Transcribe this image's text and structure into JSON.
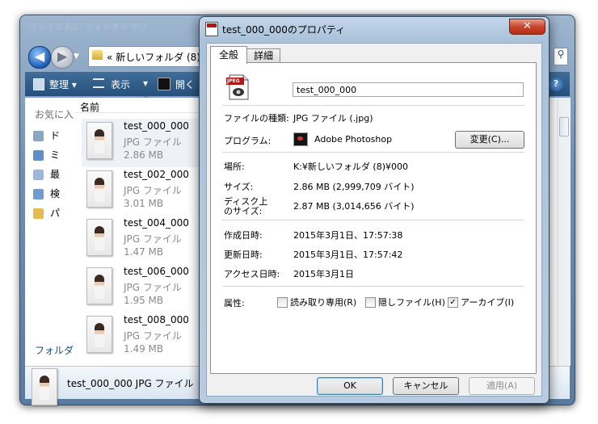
{
  "explorer": {
    "title": "ファイル名に フォトギャラリ",
    "address": "«  新しいフォルダ (8)",
    "toolbar": {
      "organize": "整理 ▾",
      "view": "表示",
      "open": "開く"
    },
    "nav_pane_header": "お気に入",
    "nav_items": [
      "ド",
      "ミ",
      "最",
      "検",
      "パ"
    ],
    "folder_label": "フォルダ",
    "column_header": "名前",
    "files": [
      {
        "name": "test_000_000",
        "type": "JPG ファイル",
        "size": "2.86 MB"
      },
      {
        "name": "test_002_000",
        "type": "JPG ファイル",
        "size": "3.01 MB"
      },
      {
        "name": "test_004_000",
        "type": "JPG ファイル",
        "size": "1.47 MB"
      },
      {
        "name": "test_006_000",
        "type": "JPG ファイル",
        "size": "1.95 MB"
      },
      {
        "name": "test_008_000",
        "type": "JPG ファイル",
        "size": "1.49 MB"
      }
    ],
    "status": "test_000_000 JPG ファイル"
  },
  "dialog": {
    "title": "test_000_000のプロパティ",
    "close": "✕",
    "tabs": [
      "全般",
      "詳細"
    ],
    "filename": "test_000_000",
    "icon_badge": "JPEG",
    "file_type_label": "ファイルの種類:",
    "file_type_value": "JPG ファイル (.jpg)",
    "program_label": "プログラム:",
    "program_value": "Adobe Photoshop",
    "change_button": "変更(C)...",
    "location_label": "場所:",
    "location_value": "K:¥新しいフォルダ (8)¥000",
    "size_label": "サイズ:",
    "size_value": "2.86 MB (2,999,709 バイト)",
    "disk_size_label_1": "ディスク上",
    "disk_size_label_2": "のサイズ:",
    "disk_size_value": "2.87 MB (3,014,656 バイト)",
    "created_label": "作成日時:",
    "created_value": "2015年3月1日、17:57:38",
    "modified_label": "更新日時:",
    "modified_value": "2015年3月1日、17:57:42",
    "accessed_label": "アクセス日時:",
    "accessed_value": "2015年3月1日",
    "attributes_label": "属性:",
    "attr_readonly": "読み取り専用(R)",
    "attr_hidden": "隠しファイル(H)",
    "attr_archive": "アーカイブ(I)",
    "attr_archive_checked": true,
    "ok": "OK",
    "cancel": "キャンセル",
    "apply": "適用(A)"
  },
  "colors": {
    "toolbar": "#2f5d8a",
    "dialog_frame": "#b8cbe0",
    "close_button": "#c9452c"
  }
}
